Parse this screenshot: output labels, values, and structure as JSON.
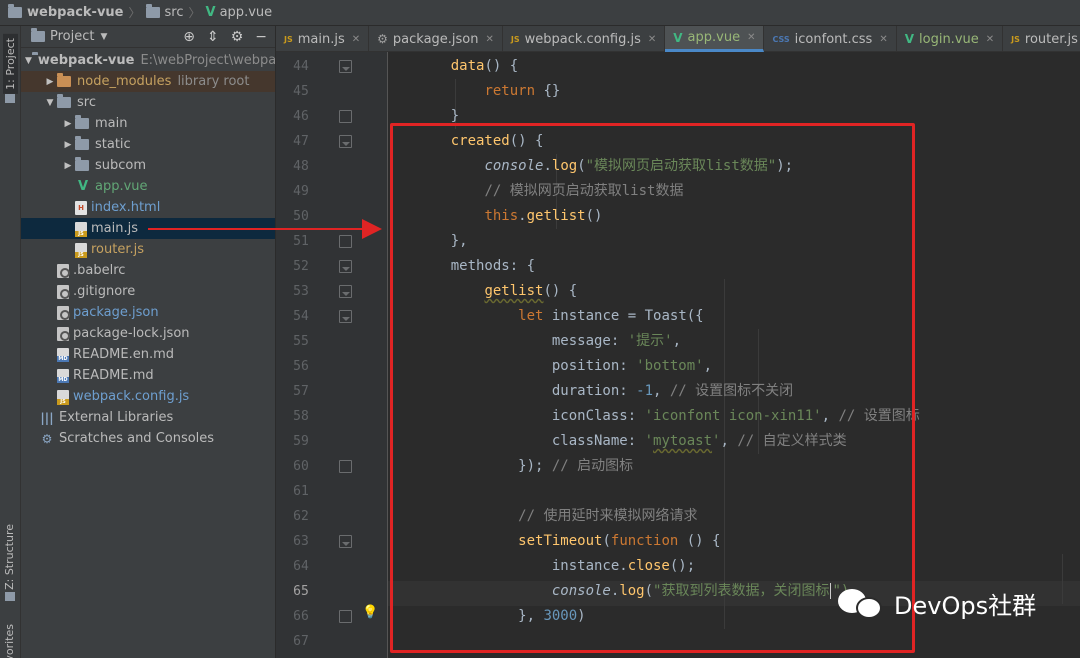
{
  "breadcrumb": {
    "items": [
      "webpack-vue",
      "src",
      "app.vue"
    ]
  },
  "tool_stripe": {
    "project_label": "1: Project",
    "structure_label": "Z: Structure",
    "favorites_label": "vorites"
  },
  "project_panel": {
    "title": "Project",
    "tree": [
      {
        "label": "webpack-vue",
        "hint": "E:\\webProject\\webpac",
        "icon": "folder-icon",
        "arrow": "▼",
        "level": 0,
        "style": "bold"
      },
      {
        "label": "node_modules",
        "hint": "library root",
        "icon": "folder-icon",
        "arrow": "▶",
        "level": 1,
        "style": "orange"
      },
      {
        "label": "src",
        "hint": "",
        "icon": "folder-icon",
        "arrow": "▼",
        "level": 1,
        "style": "normal"
      },
      {
        "label": "main",
        "hint": "",
        "icon": "folder-icon",
        "arrow": "▶",
        "level": 2,
        "style": "normal"
      },
      {
        "label": "static",
        "hint": "",
        "icon": "folder-icon",
        "arrow": "▶",
        "level": 2,
        "style": "normal"
      },
      {
        "label": "subcom",
        "hint": "",
        "icon": "folder-icon",
        "arrow": "▶",
        "level": 2,
        "style": "normal"
      },
      {
        "label": "app.vue",
        "hint": "",
        "icon": "vue-icon",
        "arrow": "",
        "level": 2,
        "style": "vue"
      },
      {
        "label": "index.html",
        "hint": "",
        "icon": "html-file-icon",
        "arrow": "",
        "level": 2,
        "style": "blue"
      },
      {
        "label": "main.js",
        "hint": "",
        "icon": "js-file-icon",
        "arrow": "",
        "level": 2,
        "style": "normal"
      },
      {
        "label": "router.js",
        "hint": "",
        "icon": "js-file-icon",
        "arrow": "",
        "level": 2,
        "style": "orange"
      },
      {
        "label": ".babelrc",
        "hint": "",
        "icon": "config-file-icon",
        "arrow": "",
        "level": 1,
        "style": "normal"
      },
      {
        "label": ".gitignore",
        "hint": "",
        "icon": "config-file-icon",
        "arrow": "",
        "level": 1,
        "style": "normal"
      },
      {
        "label": "package.json",
        "hint": "",
        "icon": "config-file-icon",
        "arrow": "",
        "level": 1,
        "style": "blue"
      },
      {
        "label": "package-lock.json",
        "hint": "",
        "icon": "config-file-icon",
        "arrow": "",
        "level": 1,
        "style": "normal"
      },
      {
        "label": "README.en.md",
        "hint": "",
        "icon": "markdown-file-icon",
        "arrow": "",
        "level": 1,
        "style": "normal"
      },
      {
        "label": "README.md",
        "hint": "",
        "icon": "markdown-file-icon",
        "arrow": "",
        "level": 1,
        "style": "normal"
      },
      {
        "label": "webpack.config.js",
        "hint": "",
        "icon": "js-file-icon",
        "arrow": "",
        "level": 1,
        "style": "blue"
      },
      {
        "label": "External Libraries",
        "hint": "",
        "icon": "library-icon",
        "arrow": "",
        "level": 0,
        "style": "normal"
      },
      {
        "label": "Scratches and Consoles",
        "hint": "",
        "icon": "scratches-icon",
        "arrow": "",
        "level": 0,
        "style": "normal"
      }
    ]
  },
  "tabs": [
    {
      "label": "main.js",
      "icon": "js-file-icon",
      "active": false
    },
    {
      "label": "package.json",
      "icon": "config-file-icon",
      "active": false
    },
    {
      "label": "webpack.config.js",
      "icon": "js-file-icon",
      "active": false
    },
    {
      "label": "app.vue",
      "icon": "vue-icon",
      "active": true
    },
    {
      "label": "iconfont.css",
      "icon": "css-file-icon",
      "active": false
    },
    {
      "label": "login.vue",
      "icon": "vue-icon",
      "active": false
    },
    {
      "label": "router.js",
      "icon": "js-file-icon",
      "active": false
    }
  ],
  "editor": {
    "current_line": 65,
    "lines": [
      {
        "n": 44,
        "fold": "down",
        "tokens": [
          [
            "    data",
            "fn"
          ],
          [
            "() {",
            "plain"
          ]
        ]
      },
      {
        "n": 45,
        "fold": "",
        "tokens": [
          [
            "        ",
            "plain"
          ],
          [
            "return",
            "kw"
          ],
          [
            " {}",
            "plain"
          ]
        ]
      },
      {
        "n": 46,
        "fold": "up",
        "tokens": [
          [
            "    }",
            "plain"
          ]
        ]
      },
      {
        "n": 47,
        "fold": "down",
        "tokens": [
          [
            "    created",
            "fn"
          ],
          [
            "() {",
            "plain"
          ]
        ]
      },
      {
        "n": 48,
        "fold": "",
        "tokens": [
          [
            "        ",
            "plain"
          ],
          [
            "console",
            "ital"
          ],
          [
            ".",
            "plain"
          ],
          [
            "log",
            "fn"
          ],
          [
            "(",
            "plain"
          ],
          [
            "\"模拟网页启动获取list数据\"",
            "str"
          ],
          [
            ");",
            "plain"
          ]
        ]
      },
      {
        "n": 49,
        "fold": "",
        "tokens": [
          [
            "        ",
            "plain"
          ],
          [
            "// 模拟网页启动获取list数据",
            "com"
          ]
        ]
      },
      {
        "n": 50,
        "fold": "",
        "tokens": [
          [
            "        ",
            "plain"
          ],
          [
            "this",
            "kw"
          ],
          [
            ".",
            "plain"
          ],
          [
            "getlist",
            "fn"
          ],
          [
            "()",
            "plain"
          ]
        ]
      },
      {
        "n": 51,
        "fold": "up",
        "tokens": [
          [
            "    },",
            "plain"
          ]
        ]
      },
      {
        "n": 52,
        "fold": "down",
        "tokens": [
          [
            "    methods",
            "prop"
          ],
          [
            ": {",
            "plain"
          ]
        ]
      },
      {
        "n": 53,
        "fold": "down",
        "tokens": [
          [
            "        ",
            "plain"
          ],
          [
            "getlist",
            "fn-under"
          ],
          [
            "() {",
            "plain"
          ]
        ]
      },
      {
        "n": 54,
        "fold": "down",
        "tokens": [
          [
            "            ",
            "plain"
          ],
          [
            "let",
            "kw"
          ],
          [
            " instance = Toast({",
            "plain"
          ]
        ]
      },
      {
        "n": 55,
        "fold": "",
        "tokens": [
          [
            "                message: ",
            "plain"
          ],
          [
            "'提示'",
            "str"
          ],
          [
            ",",
            "plain"
          ]
        ]
      },
      {
        "n": 56,
        "fold": "",
        "tokens": [
          [
            "                position: ",
            "plain"
          ],
          [
            "'bottom'",
            "str"
          ],
          [
            ",",
            "plain"
          ]
        ]
      },
      {
        "n": 57,
        "fold": "",
        "tokens": [
          [
            "                duration: ",
            "plain"
          ],
          [
            "-1",
            "num"
          ],
          [
            ", ",
            "plain"
          ],
          [
            "// 设置图标不关闭",
            "com"
          ]
        ]
      },
      {
        "n": 58,
        "fold": "",
        "tokens": [
          [
            "                iconClass: ",
            "plain"
          ],
          [
            "'iconfont icon-xin11'",
            "str"
          ],
          [
            ", ",
            "plain"
          ],
          [
            "// 设置图标",
            "com"
          ]
        ]
      },
      {
        "n": 59,
        "fold": "",
        "tokens": [
          [
            "                className: ",
            "plain"
          ],
          [
            "'",
            "str"
          ],
          [
            "mytoast",
            "str-under"
          ],
          [
            "'",
            "str"
          ],
          [
            ", ",
            "plain"
          ],
          [
            "// 自定义样式类",
            "com"
          ]
        ]
      },
      {
        "n": 60,
        "fold": "up",
        "tokens": [
          [
            "            }); ",
            "plain"
          ],
          [
            "// 启动图标",
            "com"
          ]
        ]
      },
      {
        "n": 61,
        "fold": "",
        "tokens": []
      },
      {
        "n": 62,
        "fold": "",
        "tokens": [
          [
            "            ",
            "plain"
          ],
          [
            "// 使用延时来模拟网络请求",
            "com"
          ]
        ]
      },
      {
        "n": 63,
        "fold": "down",
        "tokens": [
          [
            "            ",
            "plain"
          ],
          [
            "setTimeout",
            "fn"
          ],
          [
            "(",
            "plain"
          ],
          [
            "function",
            "kw"
          ],
          [
            " () {",
            "plain"
          ]
        ]
      },
      {
        "n": 64,
        "fold": "",
        "tokens": [
          [
            "                instance.",
            "plain"
          ],
          [
            "close",
            "fn"
          ],
          [
            "();",
            "plain"
          ]
        ]
      },
      {
        "n": 65,
        "fold": "",
        "tokens": [
          [
            "                ",
            "plain"
          ],
          [
            "console",
            "ital"
          ],
          [
            ".",
            "plain"
          ],
          [
            "log",
            "fn"
          ],
          [
            "(",
            "plain"
          ],
          [
            "\"获取到列表数据，关闭图标",
            "str"
          ],
          [
            "|",
            "caret"
          ],
          [
            "\")",
            "str"
          ]
        ]
      },
      {
        "n": 66,
        "fold": "up",
        "tokens": [
          [
            "            }, ",
            "plain"
          ],
          [
            "3000",
            "num"
          ],
          [
            ")",
            "plain"
          ]
        ]
      },
      {
        "n": 67,
        "fold": "",
        "tokens": []
      }
    ]
  },
  "watermark": {
    "text": "DevOps社群"
  }
}
